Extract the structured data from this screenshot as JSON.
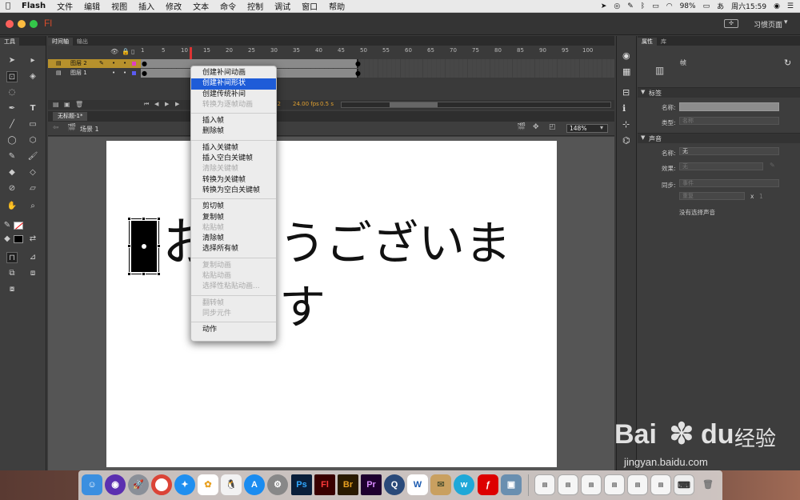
{
  "menubar": {
    "apple": "",
    "app": "Flash",
    "items": [
      "文件",
      "编辑",
      "视图",
      "插入",
      "修改",
      "文本",
      "命令",
      "控制",
      "调试",
      "窗口",
      "帮助"
    ],
    "battery": "98%",
    "clock": "周六15:59"
  },
  "titlebar": {
    "logo": "Fl",
    "workspace": "习惯页面"
  },
  "toolbar": {
    "title": "工具"
  },
  "timeline": {
    "tabs": [
      "时间轴",
      "输出"
    ],
    "ruler": [
      "1",
      "5",
      "10",
      "15",
      "20",
      "25",
      "30",
      "35",
      "40",
      "45",
      "50",
      "55",
      "60",
      "65",
      "70",
      "75",
      "80",
      "85",
      "90",
      "95",
      "100"
    ],
    "layers": [
      "图层 2",
      "图层 1"
    ],
    "frame_number": "12",
    "fps": "24.00 fps",
    "time": "0.5 s"
  },
  "document": {
    "tab": "无标题-1*",
    "scene": "场景 1",
    "zoom": "148%"
  },
  "stage": {
    "text": "おはようございます",
    "visible_text": "お",
    "visible_text2": "うございます"
  },
  "context_menu": {
    "groups": [
      [
        {
          "label": "创建补间动画",
          "disabled": false
        },
        {
          "label": "创建补间形状",
          "disabled": false,
          "highlighted": true
        },
        {
          "label": "创建传统补间",
          "disabled": false
        },
        {
          "label": "转换为逐帧动画",
          "disabled": true
        }
      ],
      [
        {
          "label": "插入帧",
          "disabled": false
        },
        {
          "label": "删除帧",
          "disabled": false
        }
      ],
      [
        {
          "label": "插入关键帧",
          "disabled": false
        },
        {
          "label": "插入空白关键帧",
          "disabled": false
        },
        {
          "label": "清除关键帧",
          "disabled": true
        },
        {
          "label": "转换为关键帧",
          "disabled": false
        },
        {
          "label": "转换为空白关键帧",
          "disabled": false
        }
      ],
      [
        {
          "label": "剪切帧",
          "disabled": false
        },
        {
          "label": "复制帧",
          "disabled": false
        },
        {
          "label": "粘贴帧",
          "disabled": true
        },
        {
          "label": "清除帧",
          "disabled": false
        },
        {
          "label": "选择所有帧",
          "disabled": false
        }
      ],
      [
        {
          "label": "复制动画",
          "disabled": true
        },
        {
          "label": "粘贴动画",
          "disabled": true
        },
        {
          "label": "选择性粘贴动画...",
          "disabled": true
        }
      ],
      [
        {
          "label": "翻转帧",
          "disabled": true
        },
        {
          "label": "同步元件",
          "disabled": true
        }
      ],
      [
        {
          "label": "动作",
          "disabled": false
        }
      ]
    ]
  },
  "properties": {
    "tabs": [
      "属性",
      "库"
    ],
    "object": "帧",
    "label_section": "标签",
    "name_label": "名称:",
    "type_label": "类型:",
    "type_value": "名称",
    "sound_section": "声音",
    "sound_name_label": "名称:",
    "sound_name_value": "无",
    "effect_label": "效果:",
    "effect_value": "无",
    "sync_label": "同步:",
    "sync_value": "事件",
    "repeat_value": "重复",
    "repeat_x": "x",
    "repeat_count": "1",
    "no_sound": "没有选择声音"
  },
  "watermark": {
    "brand": "Bai",
    "brand2": "du",
    "cn": "经验",
    "url": "jingyan.baidu.com"
  },
  "dock": [
    "Finder",
    "Siri",
    "Launchpad",
    "Chrome",
    "Safari",
    "Photos",
    "QQ",
    "App Store",
    "System Preferences",
    "Ps",
    "Fl",
    "Br",
    "Pr",
    "QuickTime",
    "Word",
    "Preview",
    "Wunderlist",
    "Flash Player",
    "Image Capture"
  ]
}
